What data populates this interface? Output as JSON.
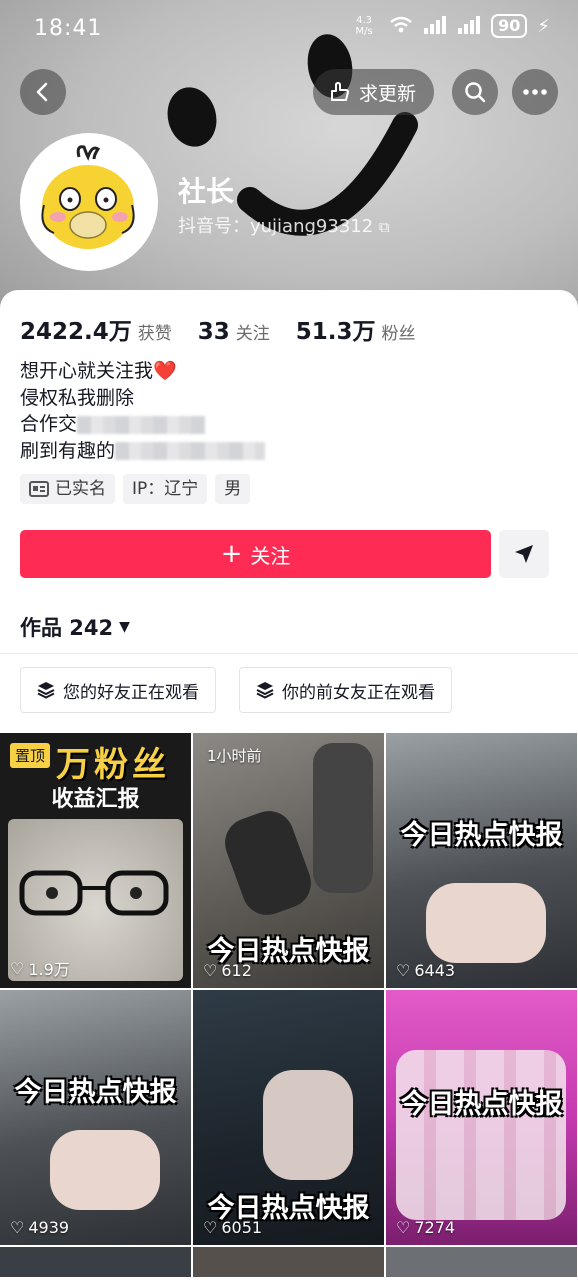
{
  "status_bar": {
    "time": "18:41",
    "net_speed": "4.3 M/s",
    "battery": "90"
  },
  "header": {
    "request_update_label": "求更新"
  },
  "profile": {
    "nickname": "社长",
    "douyin_id": "抖音号：yujiang93312",
    "likes_count": "2422.4万",
    "likes_label": "获赞",
    "following_count": "33",
    "following_label": "关注",
    "followers_count": "51.3万",
    "followers_label": "粉丝",
    "bio": [
      "想开心就关注我❤️",
      "侵权私我删除",
      "合作交",
      "刷到有趣的"
    ],
    "tags": [
      "已实名",
      "IP：辽宁",
      "男"
    ]
  },
  "actions": {
    "follow_label": "关注"
  },
  "works": {
    "label": "作品 242"
  },
  "watching": [
    "您的好友正在观看",
    "你的前女友正在观看"
  ],
  "videos": [
    {
      "likes": "1.9万",
      "pinned_label": "置顶",
      "overlay_title": "万粉丝",
      "overlay_subtitle": "收益汇报"
    },
    {
      "likes": "612",
      "time_label": "1小时前",
      "overlay_text": "今日热点快报"
    },
    {
      "likes": "6443",
      "overlay_text": "今日热点快报"
    },
    {
      "likes": "4939",
      "overlay_text": "今日热点快报"
    },
    {
      "likes": "6051",
      "overlay_text": "今日热点快报"
    },
    {
      "likes": "7274",
      "overlay_text": "今日热点快报"
    }
  ],
  "colors": {
    "primary": "#fe2c55",
    "pin_badge": "#f7d046"
  }
}
